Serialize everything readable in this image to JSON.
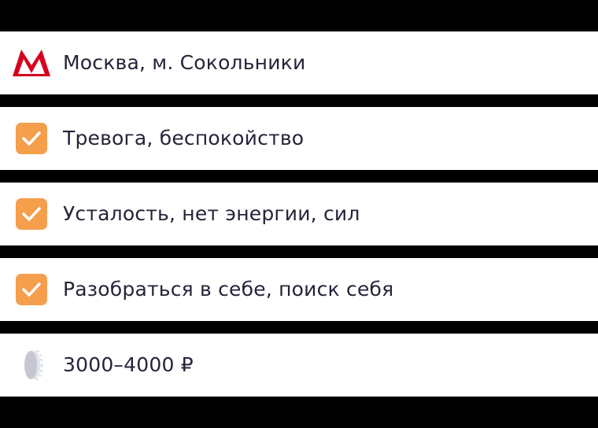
{
  "rows": [
    {
      "icon": "metro-icon",
      "text": "Москва, м. Сокольники"
    },
    {
      "icon": "checkbox-checked",
      "text": "Тревога, беспокойство"
    },
    {
      "icon": "checkbox-checked",
      "text": "Усталость, нет энергии, сил"
    },
    {
      "icon": "checkbox-checked",
      "text": "Разобраться в себе, поиск себя"
    },
    {
      "icon": "coin-icon",
      "text": "3000–4000 ₽"
    }
  ],
  "colors": {
    "metro_red": "#d6001c",
    "checkbox_orange": "#f59e4c",
    "text": "#24243a",
    "coin_gray": "#c4c6d2"
  }
}
